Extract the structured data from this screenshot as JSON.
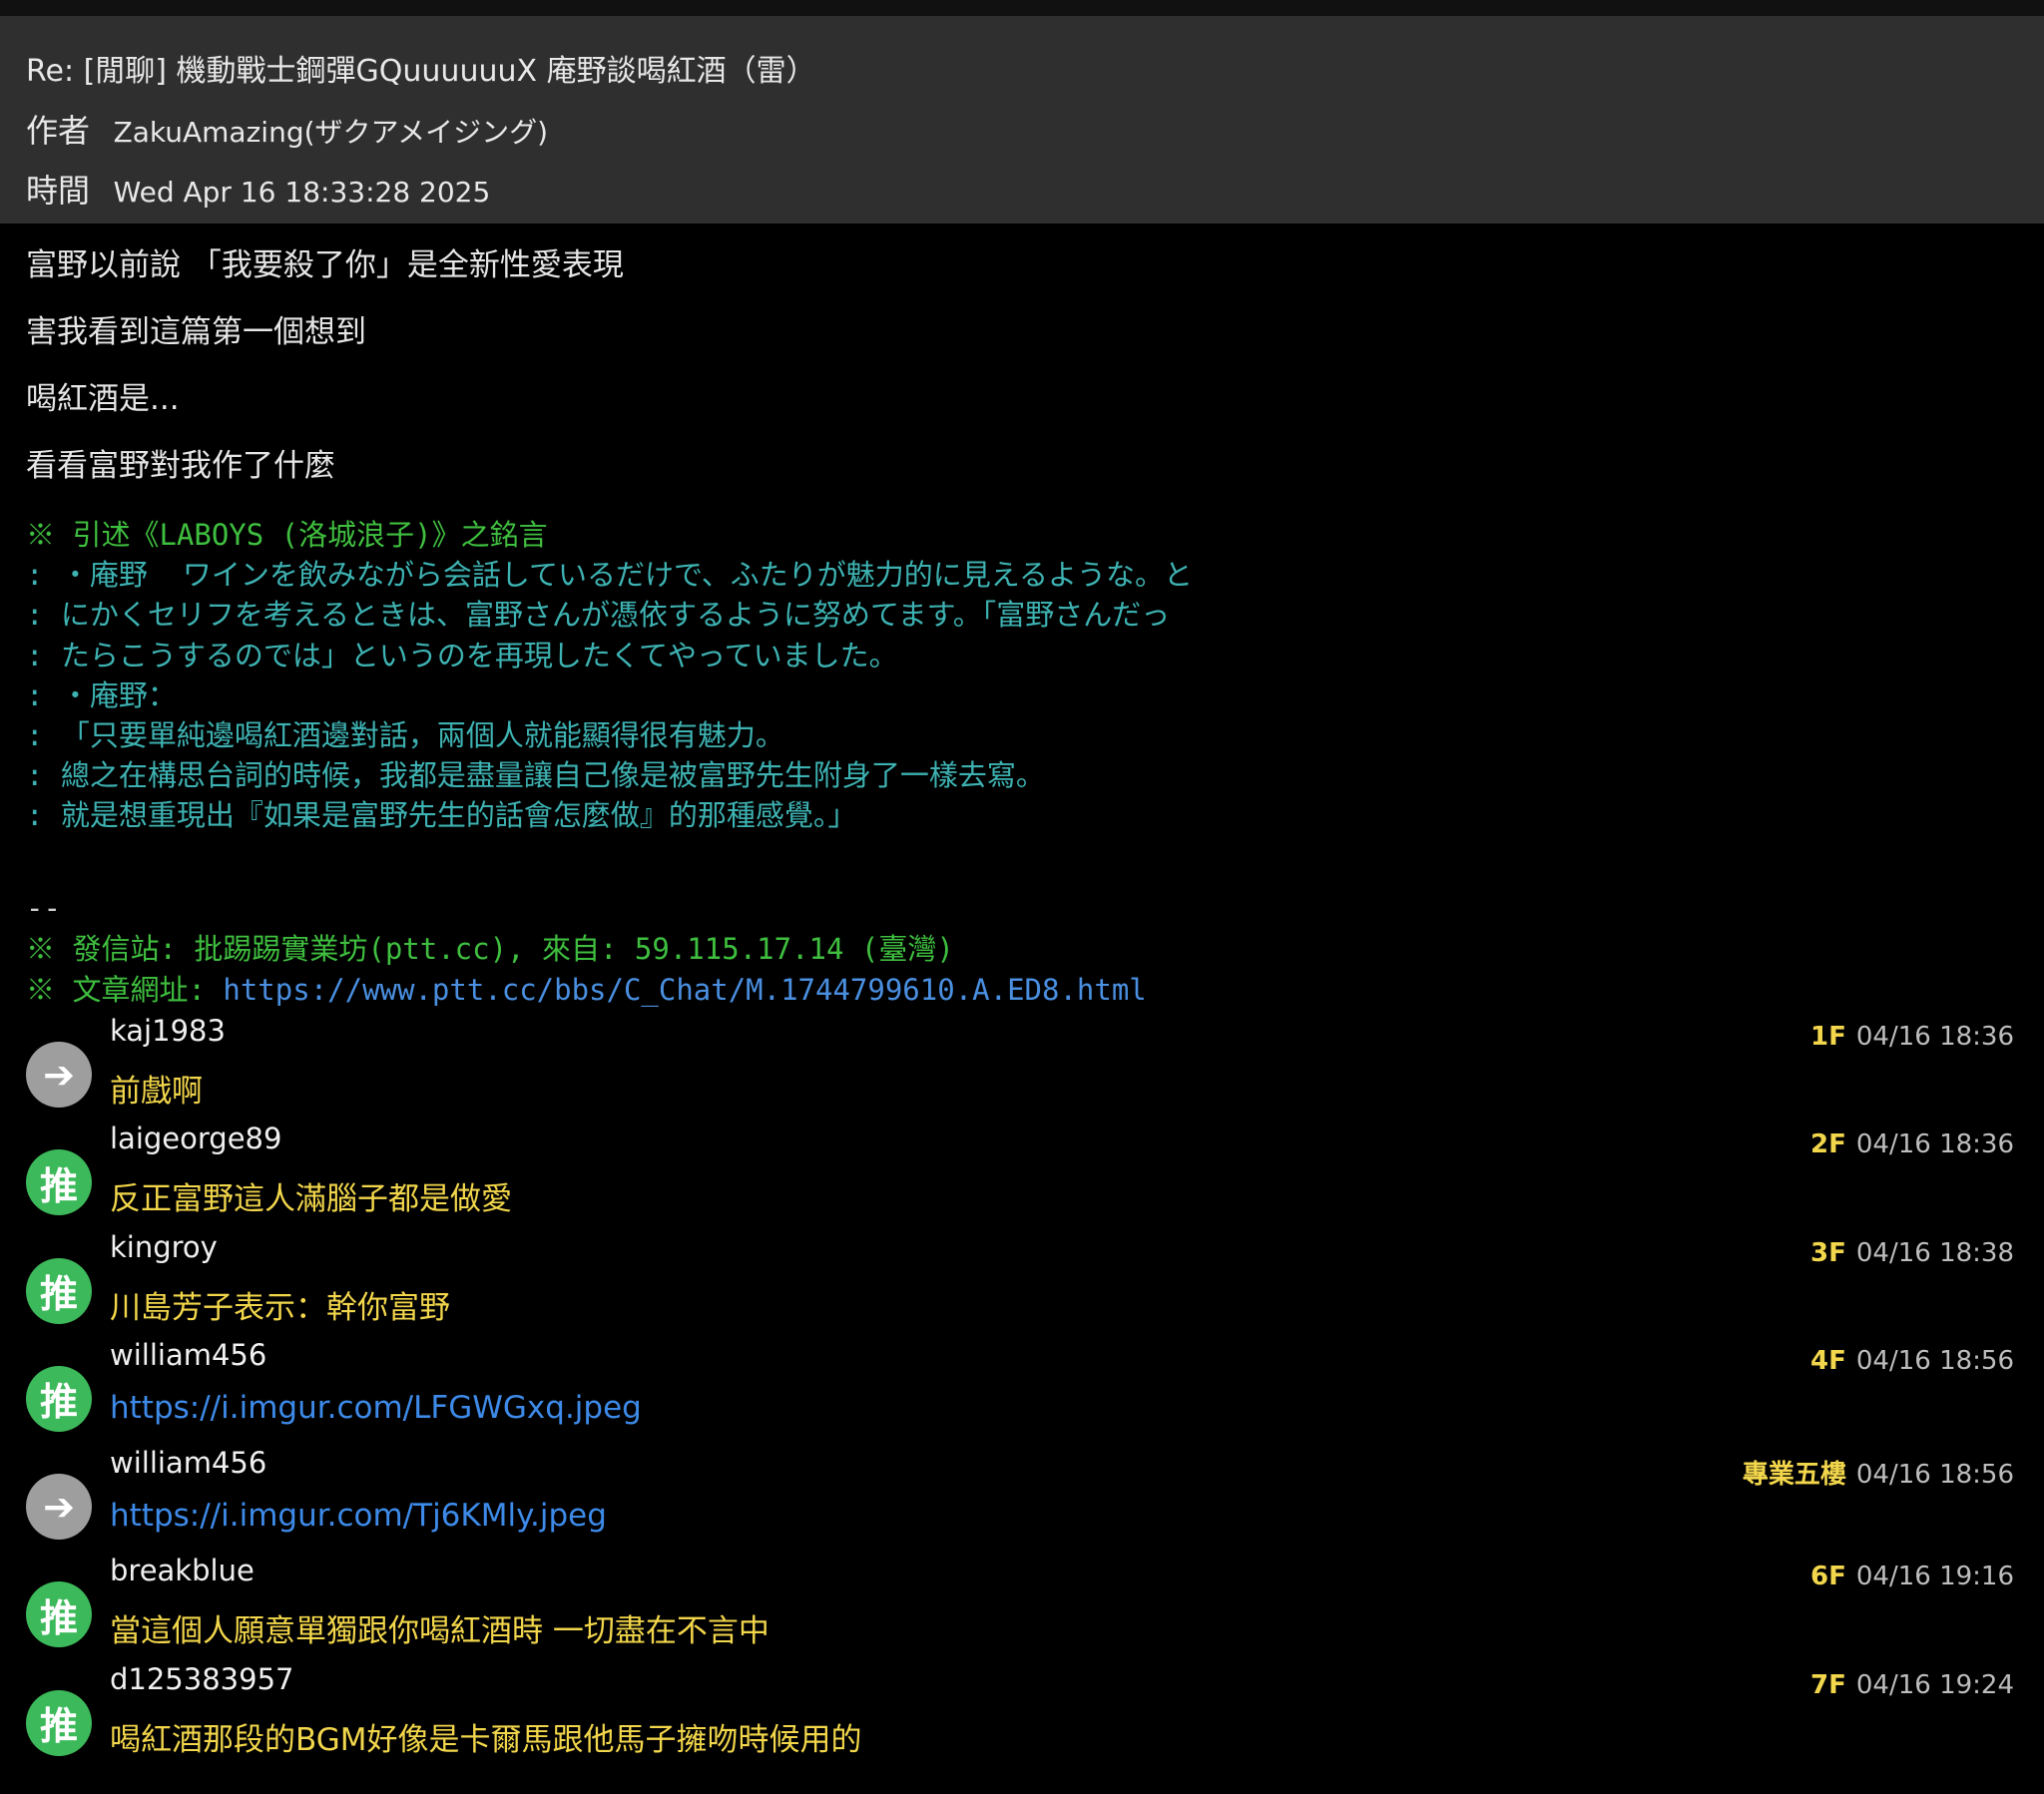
{
  "header": {
    "title": "Re: [閒聊] 機動戰士鋼彈GQuuuuuuX  庵野談喝紅酒（雷）",
    "author_label": "作者",
    "author": "ZakuAmazing(ザクアメイジング)",
    "time_label": "時間",
    "time": "Wed Apr 16 18:33:28 2025"
  },
  "body": {
    "paragraphs": [
      "富野以前說  「我要殺了你」是全新性愛表現",
      "害我看到這篇第一個想到",
      "喝紅酒是...",
      "看看富野對我作了什麼"
    ]
  },
  "quote": {
    "header": "※ 引述《LABOYS (洛城浪子)》之銘言",
    "lines": [
      ": ・庵野  ワインを飲みながら会話しているだけで、ふたりが魅力的に見えるような。と",
      ": にかくセリフを考えるときは、富野さんが憑依するように努めてます。「富野さんだっ",
      ": たらこうするのでは」というのを再現したくてやっていました。",
      ": ・庵野：",
      ": 「只要單純邊喝紅酒邊對話，兩個人就能顯得很有魅力。",
      ": 總之在構思台詞的時候，我都是盡量讓自己像是被富野先生附身了一樣去寫。",
      ": 就是想重現出『如果是富野先生的話會怎麼做』的那種感覺。」"
    ]
  },
  "signature": {
    "dash": "--",
    "station": "※ 發信站: 批踢踢實業坊(ptt.cc), 來自: 59.115.17.14 (臺灣)",
    "url_label": "※ 文章網址: ",
    "url": "https://www.ptt.cc/bbs/C_Chat/M.1744799610.A.ED8.html"
  },
  "colors": {
    "push": "#3cb95a",
    "arrow": "#9e9e9e",
    "comment_text": "#f2d64b",
    "link": "#3d8ae8",
    "quote": "#3eb2b2",
    "signature": "#3fbf3f"
  },
  "comments": [
    {
      "icon": "arrow-icon",
      "icon_glyph": "➔",
      "user": "kaj1983",
      "floor": "1F",
      "date": "04/16 18:36",
      "text": "前戲啊"
    },
    {
      "icon": "push-icon",
      "icon_glyph": "推",
      "user": "laigeorge89",
      "floor": "2F",
      "date": "04/16 18:36",
      "text": "反正富野這人滿腦子都是做愛"
    },
    {
      "icon": "push-icon",
      "icon_glyph": "推",
      "user": "kingroy",
      "floor": "3F",
      "date": "04/16 18:38",
      "text": "川島芳子表示：幹你富野"
    },
    {
      "icon": "push-icon",
      "icon_glyph": "推",
      "user": "william456",
      "floor": "4F",
      "date": "04/16 18:56",
      "text": "https://i.imgur.com/LFGWGxq.jpeg"
    },
    {
      "icon": "arrow-icon",
      "icon_glyph": "➔",
      "user": "william456",
      "floor": "專業五樓",
      "date": "04/16 18:56",
      "text": "https://i.imgur.com/Tj6KMly.jpeg"
    },
    {
      "icon": "push-icon",
      "icon_glyph": "推",
      "user": "breakblue",
      "floor": "6F",
      "date": "04/16 19:16",
      "text": "當這個人願意單獨跟你喝紅酒時 一切盡在不言中"
    },
    {
      "icon": "push-icon",
      "icon_glyph": "推",
      "user": "d125383957",
      "floor": "7F",
      "date": "04/16 19:24",
      "text": "喝紅酒那段的BGM好像是卡爾馬跟他馬子擁吻時候用的"
    }
  ]
}
